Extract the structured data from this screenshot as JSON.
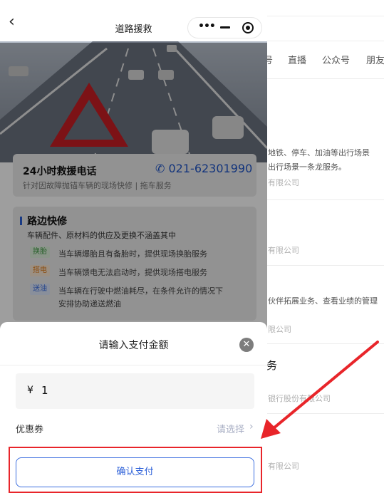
{
  "background": {
    "tabs": [
      "号",
      "直播",
      "公众号",
      "朋友"
    ],
    "lines": [
      "地铁、停车、加油等出行场景",
      "出行场景一条龙服务。",
      "有限公司",
      "有限公司",
      "伙伴拓展业务、查看业绩的管理",
      "限公司",
      "务",
      "银行股份有限公司",
      "有限公司"
    ]
  },
  "navbar": {
    "back_label": "‹",
    "title": "道路援救",
    "capsule_dots": "•••"
  },
  "hotline": {
    "title": "24小时救援电话",
    "phone": "021-62301990",
    "subtitle": "针对因故障抛锚车辆的现场快修 | 拖车服务"
  },
  "service": {
    "title": "路边快修",
    "subtitle": "车辆配件、原材料的供应及更换不涵盖其中",
    "items": [
      {
        "tag": "换胎",
        "tag_color": "#4caf50",
        "desc": "当车辆爆胎且有备胎时，提供现场换胎服务"
      },
      {
        "tag": "搭电",
        "tag_color": "#f08a24",
        "desc": "当车辆馈电无法启动时，提供现场搭电服务"
      },
      {
        "tag": "送油",
        "tag_color": "#3d6fe0",
        "desc": "当车辆在行驶中燃油耗尽，在条件允许的情况下"
      }
    ],
    "extra_line": "安排协助递送燃油"
  },
  "sheet": {
    "title": "请输入支付金额",
    "close_label": "✕",
    "currency_symbol": "¥",
    "amount_value": "1",
    "coupon_label": "优惠券",
    "coupon_placeholder": "请选择",
    "coupon_chevron": "›",
    "confirm_label": "确认支付"
  },
  "colors": {
    "accent": "#2b5fd8",
    "annotation": "#e8252a"
  }
}
